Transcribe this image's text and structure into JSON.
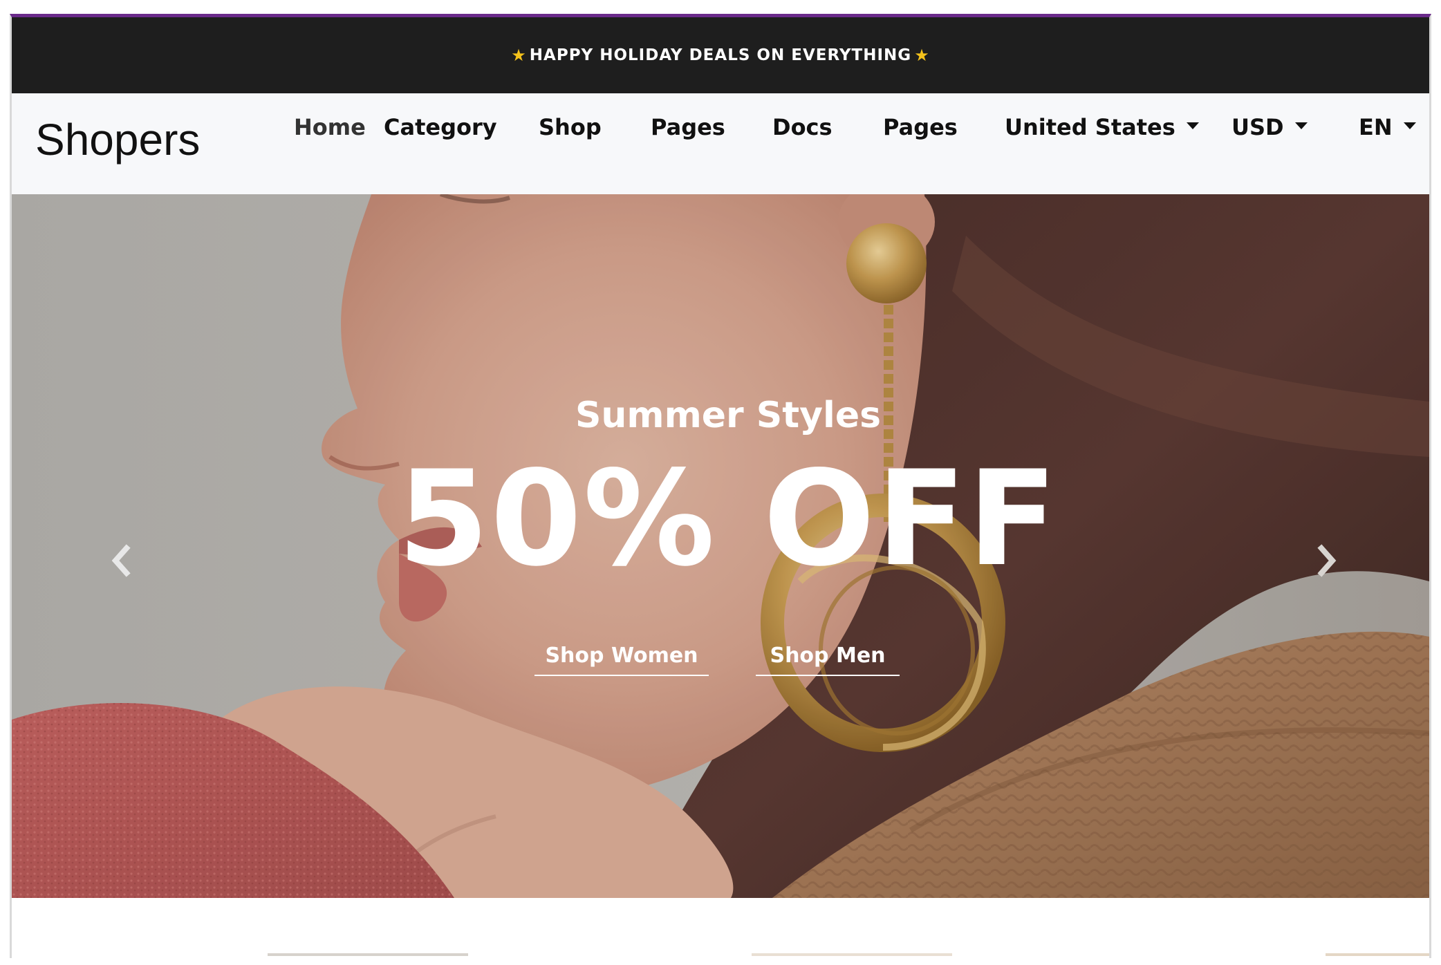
{
  "announcement": {
    "star_left": "★",
    "text": "HAPPY HOLIDAY DEALS ON EVERYTHING",
    "star_right": "★"
  },
  "brand": "Shopers",
  "nav": {
    "items": [
      "Home",
      "Category",
      "Shop",
      "Pages",
      "Docs",
      "Pages"
    ],
    "country": "United States",
    "currency": "USD",
    "language": "EN"
  },
  "hero": {
    "subtitle": "Summer Styles",
    "headline": "50% OFF",
    "cta_women": "Shop Women",
    "cta_men": "Shop Men",
    "prev_icon": "chevron-left-icon",
    "next_icon": "chevron-right-icon"
  },
  "colors": {
    "announce_bg": "#1e1e1e",
    "top_border": "#6a2a8a",
    "navbar_bg": "#f7f8fa",
    "star": "#f4c21b"
  }
}
